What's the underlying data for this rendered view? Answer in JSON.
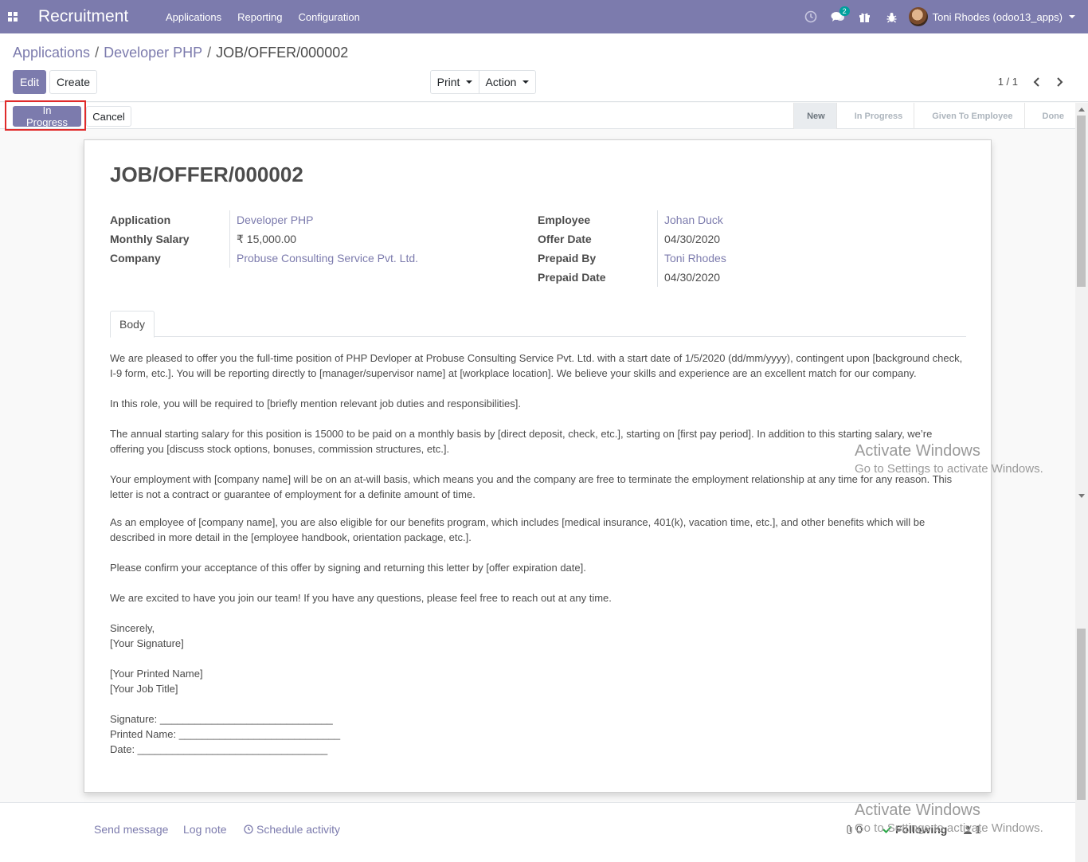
{
  "navbar": {
    "brand": "Recruitment",
    "menu": [
      "Applications",
      "Reporting",
      "Configuration"
    ],
    "message_count": "2",
    "user_name": "Toni Rhodes (odoo13_apps)"
  },
  "breadcrumb": {
    "items": [
      "Applications",
      "Developer PHP"
    ],
    "current": "JOB/OFFER/000002",
    "separator": "/"
  },
  "toolbar": {
    "edit_label": "Edit",
    "create_label": "Create",
    "print_label": "Print",
    "action_label": "Action",
    "pager": "1 / 1"
  },
  "statusbar": {
    "in_progress_label": "In Progress",
    "cancel_label": "Cancel",
    "stages": [
      "New",
      "In Progress",
      "Given To Employee",
      "Done"
    ],
    "active_stage": "New"
  },
  "form": {
    "title": "JOB/OFFER/000002",
    "left_fields": [
      {
        "label": "Application",
        "value": "Developer PHP"
      },
      {
        "label": "Monthly Salary",
        "value": "₹ 15,000.00"
      },
      {
        "label": "Company",
        "value": "Probuse Consulting Service Pvt. Ltd."
      }
    ],
    "right_fields": [
      {
        "label": "Employee",
        "value": "Johan Duck"
      },
      {
        "label": "Offer Date",
        "value": "04/30/2020"
      },
      {
        "label": "Prepaid By",
        "value": "Toni Rhodes"
      },
      {
        "label": "Prepaid Date",
        "value": "04/30/2020"
      }
    ],
    "tab_label": "Body",
    "body": {
      "p1": "We are pleased to offer you the full-time position of PHP Devloper at Probuse Consulting Service Pvt. Ltd. with a start date of 1/5/2020 (dd/mm/yyyy), contingent upon [background check, I-9 form, etc.]. You will be reporting directly to [manager/supervisor name] at [workplace location]. We believe your skills and experience are an excellent match for our company.",
      "p2": "In this role, you will be required to [briefly mention relevant job duties and responsibilities].",
      "p3": "The annual starting salary for this position is 15000 to be paid on a monthly basis by [direct deposit, check, etc.], starting on [first pay period]. In addition to this starting salary, we’re offering you [discuss stock options, bonuses, commission structures, etc.].",
      "p4": "Your employment with [company name] will be on an at-will basis, which means you and the company are free to terminate the employment relationship at any time for any reason. This letter is not a contract or guarantee of employment for a definite amount of time.",
      "p5": "As an employee of [company name], you are also eligible for our benefits program, which includes [medical insurance, 401(k), vacation time, etc.], and other benefits which will be described in more detail in the [employee handbook, orientation package, etc.].",
      "p6": "Please confirm your acceptance of this offer by signing and returning this letter by [offer expiration date].",
      "p7": "We are excited to have you join our team! If you have any questions, please feel free to reach out at any time.",
      "sincerely": "Sincerely,",
      "your_signature": "[Your Signature]",
      "printed_name_placeholder": "[Your Printed Name]",
      "job_title_placeholder": "[Your Job Title]",
      "signature_line": "Signature: ______________________________",
      "printed_name_line": "Printed Name: ____________________________",
      "date_line": "Date: _________________________________"
    }
  },
  "chatter": {
    "send_message": "Send message",
    "log_note": "Log note",
    "schedule_activity": "Schedule activity",
    "attachments_count": "0",
    "following": "Following",
    "followers_count": "1"
  },
  "watermark": {
    "line1": "Activate Windows",
    "line2": "Go to Settings to activate Windows."
  },
  "colors": {
    "brand": "#7c7bad",
    "highlight": "#e02b2b",
    "badge": "#00a09d"
  }
}
